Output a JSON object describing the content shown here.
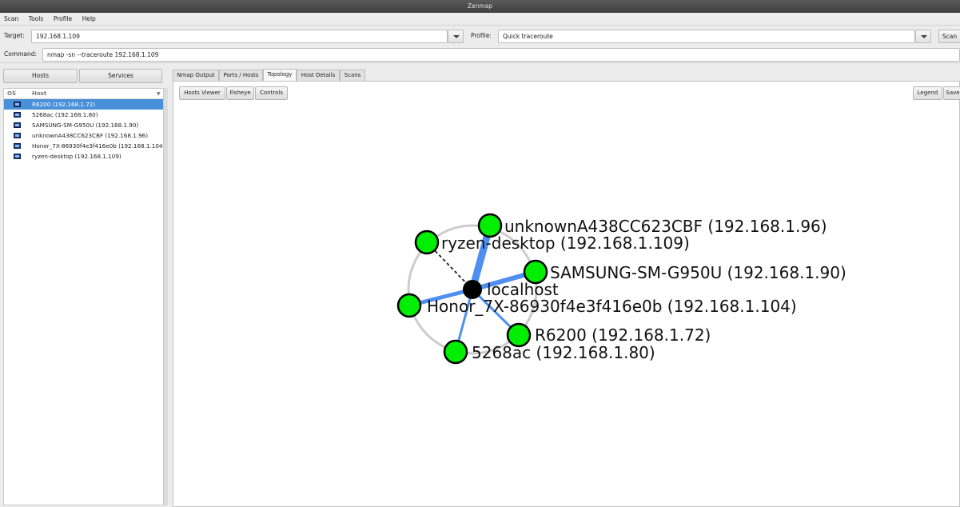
{
  "window": {
    "title": "Zenmap"
  },
  "menu": [
    "Scan",
    "Tools",
    "Profile",
    "Help"
  ],
  "toolbar": {
    "target_label": "Target:",
    "target_value": "192.168.1.109",
    "profile_label": "Profile:",
    "profile_value": "Quick traceroute",
    "scan_label": "Scan",
    "command_label": "Command:",
    "command_value": "nmap -sn --traceroute 192.168.1.109"
  },
  "sidebar": {
    "hosts_button": "Hosts",
    "services_button": "Services",
    "columns": {
      "os": "OS",
      "host": "Host"
    },
    "hosts": [
      "R6200 (192.168.1.72)",
      "5268ac (192.168.1.80)",
      "SAMSUNG-SM-G950U (192.168.1.90)",
      "unknownA438CC623CBF (192.168.1.96)",
      "Honor_7X-86930f4e3f416e0b (192.168.1.104)",
      "ryzen-desktop (192.168.1.109)"
    ]
  },
  "tabs": [
    "Nmap Output",
    "Ports / Hosts",
    "Topology",
    "Host Details",
    "Scans"
  ],
  "topology": {
    "buttons": {
      "hosts_viewer": "Hosts Viewer",
      "fisheye": "Fisheye",
      "controls": "Controls",
      "legend": "Legend",
      "save": "Save"
    },
    "center_label": "localhost",
    "nodes": [
      "unknownA438CC623CBF (192.168.1.96)",
      "ryzen-desktop (192.168.1.109)",
      "SAMSUNG-SM-G950U (192.168.1.90)",
      "Honor_7X-86930f4e3f416e0b (192.168.1.104)",
      "R6200 (192.168.1.72)",
      "5268ac (192.168.1.80)"
    ]
  },
  "colors": {
    "selection": "#4a90d9",
    "node_fill": "#00ee00",
    "edge": "#4f8ff0",
    "ring": "#cccccc"
  }
}
